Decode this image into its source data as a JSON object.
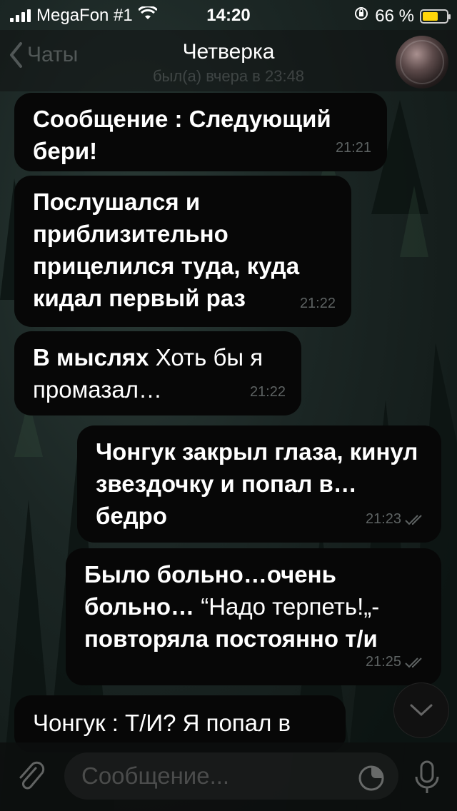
{
  "status_bar": {
    "carrier": "MegaFon #1",
    "time": "14:20",
    "battery_percent": "66 %",
    "battery_level": 0.66
  },
  "header": {
    "back_label": "Чаты",
    "title": "Четверка",
    "subtitle": "был(а) вчера в 23:48",
    "avatar_icon": "group-avatar"
  },
  "messages": [
    {
      "direction": "in",
      "bold": "Сообщение : Следующий бери!",
      "text": "",
      "time": "21:21"
    },
    {
      "direction": "in",
      "bold": "Послушался и приблизительно прицелился туда, куда кидал первый раз",
      "text": "",
      "time": "21:22"
    },
    {
      "direction": "in",
      "bold": "В мыслях",
      "text": " Хоть бы я промазал…",
      "time": "21:22"
    },
    {
      "direction": "out",
      "bold": "Чонгук закрыл глаза, кинул звездочку и попал в…бедро",
      "text": "",
      "time": "21:23"
    },
    {
      "direction": "out",
      "bold": "Было больно…очень больно…",
      "text": " “Надо терпеть!„-",
      "bold2": "повторяла постоянно т/и",
      "time": "21:25"
    },
    {
      "direction": "in",
      "bold": "",
      "text": "Чонгук : Т/И? Я попал в",
      "time": ""
    }
  ],
  "input": {
    "placeholder": "Сообщение..."
  },
  "icons": {
    "back": "chevron-left-icon",
    "attach": "paperclip-icon",
    "sticker": "sticker-icon",
    "mic": "microphone-icon",
    "scroll": "chevron-down-icon",
    "read": "double-check-icon"
  },
  "colors": {
    "bubble": "#070707",
    "battery": "#ffd60a",
    "time_text": "#5d6262"
  }
}
